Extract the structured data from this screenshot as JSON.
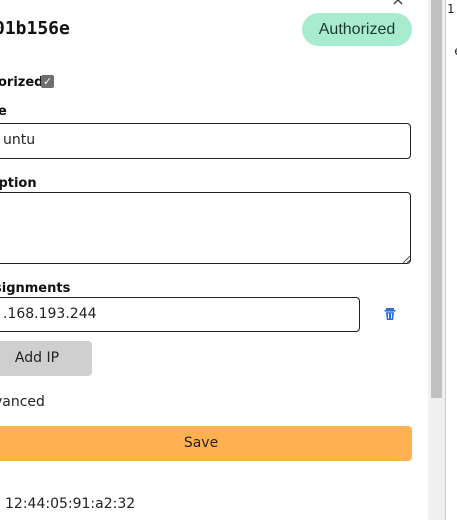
{
  "window": {
    "close_glyph": "×"
  },
  "member": {
    "id_fragment": "01b156e",
    "status_badge": "Authorized",
    "status_color": "#a8ecd0"
  },
  "form": {
    "authorized_label": "orized",
    "authorized_checked": true,
    "name_label": "e",
    "name_value": "untu",
    "description_label": "iption",
    "description_value": "",
    "ip_assignments_label": "signments",
    "ip_value": ".168.193.244",
    "delete_icon": "trash-icon",
    "add_ip_label": "Add IP",
    "advanced_label": "vanced",
    "save_label": "Save",
    "save_color": "#ffb050"
  },
  "details": {
    "mac_address": "12:44:05:91:a2:32"
  },
  "background_window": {
    "text": "1\n\n\n e"
  }
}
